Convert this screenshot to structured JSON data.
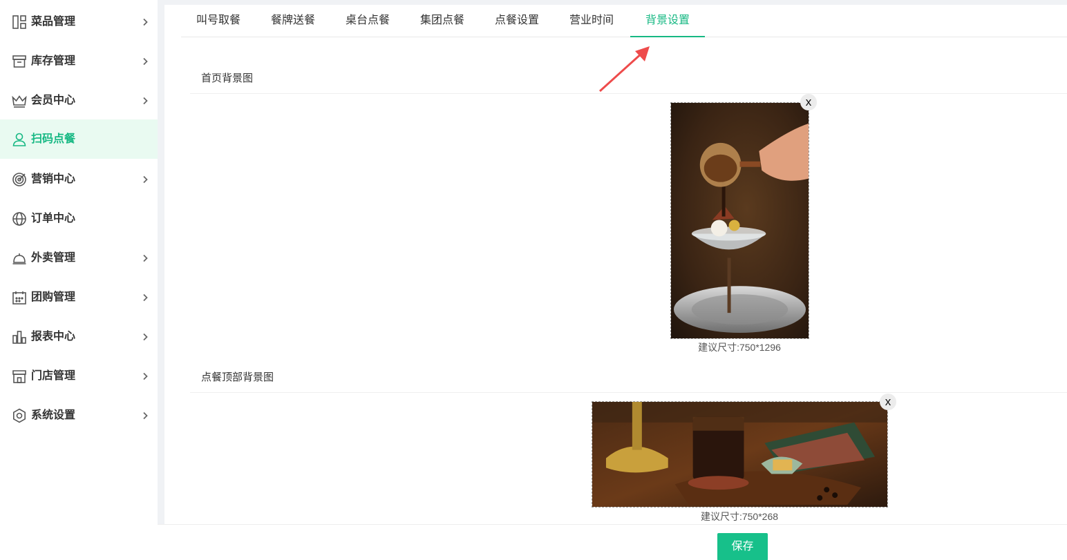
{
  "sidebar": {
    "items": [
      {
        "label": "菜品管理",
        "icon": "dishes-grid-icon",
        "has_arrow": true
      },
      {
        "label": "库存管理",
        "icon": "inventory-box-icon",
        "has_arrow": true
      },
      {
        "label": "会员中心",
        "icon": "crown-icon",
        "has_arrow": true
      },
      {
        "label": "扫码点餐",
        "icon": "user-icon",
        "has_arrow": false,
        "active": true
      },
      {
        "label": "营销中心",
        "icon": "target-icon",
        "has_arrow": true
      },
      {
        "label": "订单中心",
        "icon": "globe-icon",
        "has_arrow": false
      },
      {
        "label": "外卖管理",
        "icon": "service-bell-icon",
        "has_arrow": true
      },
      {
        "label": "团购管理",
        "icon": "calendar-icon",
        "has_arrow": true
      },
      {
        "label": "报表中心",
        "icon": "bar-chart-icon",
        "has_arrow": true
      },
      {
        "label": "门店管理",
        "icon": "storefront-icon",
        "has_arrow": true
      },
      {
        "label": "系统设置",
        "icon": "gear-icon",
        "has_arrow": true
      }
    ]
  },
  "tabs": [
    {
      "label": "叫号取餐"
    },
    {
      "label": "餐牌送餐"
    },
    {
      "label": "桌台点餐"
    },
    {
      "label": "集团点餐"
    },
    {
      "label": "点餐设置"
    },
    {
      "label": "营业时间"
    },
    {
      "label": "背景设置",
      "active": true
    }
  ],
  "sections": {
    "home": {
      "title": "首页背景图",
      "hint": "建议尺寸:750*1296",
      "close": "x"
    },
    "top": {
      "title": "点餐顶部背景图",
      "hint": "建议尺寸:750*268",
      "close": "x"
    }
  },
  "footer": {
    "save_label": "保存"
  },
  "colors": {
    "accent": "#16b883",
    "active_bg": "#e9faf1",
    "save_button": "#17c08a",
    "annotation_arrow": "#ee4b4b"
  }
}
